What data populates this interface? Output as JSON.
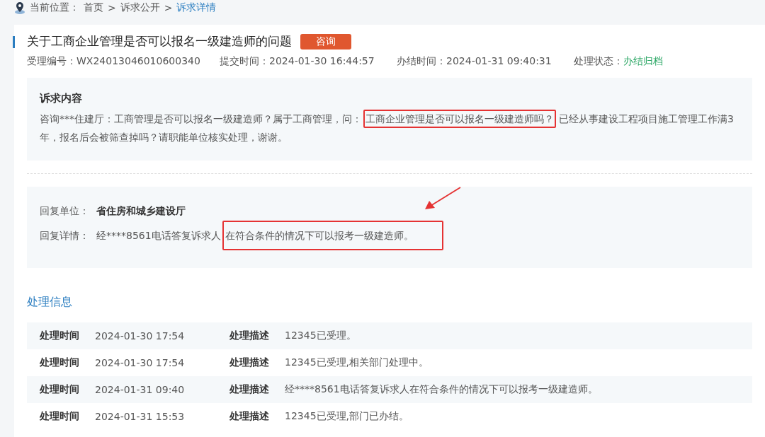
{
  "breadcrumb": {
    "label": "当前位置：",
    "separator": ">",
    "items": [
      {
        "text": "首页",
        "selected": false
      },
      {
        "text": "诉求公开",
        "selected": false
      },
      {
        "text": "诉求详情",
        "selected": true
      }
    ]
  },
  "title": "关于工商企业管理是否可以报名一级建造师的问题",
  "tag": "咨询",
  "meta": [
    {
      "label": "受理编号：",
      "value": "WX24013046010600340",
      "kind": "plain"
    },
    {
      "label": "提交时间：",
      "value": "2024-01-30 16:44:57",
      "kind": "plain"
    },
    {
      "label": "办结时间：",
      "value": "2024-01-31 09:40:31",
      "kind": "plain"
    },
    {
      "label": "处理状态：",
      "value": "办结归档",
      "kind": "status"
    }
  ],
  "request": {
    "heading": "诉求内容",
    "segments": [
      {
        "text": "咨询***住建厅：工商管理是否可以报名一级建造师？属于工商管理，问：",
        "highlighted": false
      },
      {
        "text": "工商企业管理是否可以报名一级建造师吗？",
        "highlighted": true
      },
      {
        "text": "已经从事建设工程项目施工管理工作满3年，报名后会被筛查掉吗？请职能单位核实处理，谢谢。",
        "highlighted": false
      }
    ]
  },
  "reply": {
    "unit_label": "回复单位：",
    "unit": "省住房和城乡建设厅",
    "detail_label": "回复详情：",
    "segments": [
      {
        "text": "经****8561电话答复诉求人",
        "highlighted": false
      },
      {
        "text": "在符合条件的情况下可以报考一级建造师。",
        "highlighted": true
      }
    ],
    "arrow": true
  },
  "process": {
    "heading": "处理信息",
    "rows": [
      {
        "time_label": "处理时间",
        "time": "2024-01-30 17:54",
        "desc_label": "处理描述",
        "desc": "12345已受理。"
      },
      {
        "time_label": "处理时间",
        "time": "2024-01-30 17:54",
        "desc_label": "处理描述",
        "desc": "12345已受理,相关部门处理中。"
      },
      {
        "time_label": "处理时间",
        "time": "2024-01-31 09:40",
        "desc_label": "处理描述",
        "desc": "经****8561电话答复诉求人在符合条件的情况下可以报考一级建造师。"
      },
      {
        "time_label": "处理时间",
        "time": "2024-01-31 15:53",
        "desc_label": "处理描述",
        "desc": "12345已受理,部门已办结。"
      }
    ]
  }
}
